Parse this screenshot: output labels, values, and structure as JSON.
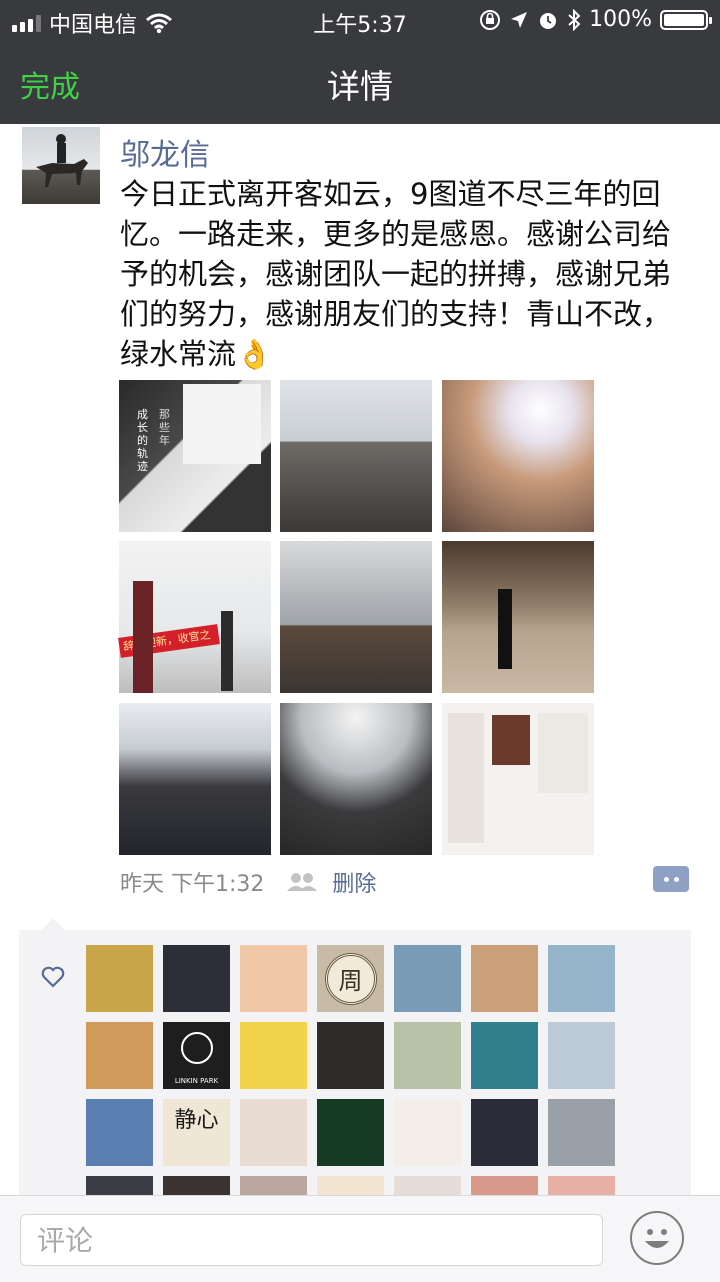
{
  "status_bar": {
    "carrier": "中国电信",
    "time": "上午5:37",
    "battery": "100%",
    "battery_level": 1.0
  },
  "nav": {
    "back_label": "完成",
    "title": "详情"
  },
  "post": {
    "author": "邬龙信",
    "text": "今日正式离开客如云，9图道不尽三年的回忆。一路走来，更多的是感恩。感谢公司给予的机会，感谢团队一起的拼搏，感谢兄弟们的努力，感谢朋友们的支持！青山不改，绿水常流👌",
    "photo_texts": {
      "wall_poster": "成长的轨迹",
      "wall_poster_2": "那些年",
      "banner": "辞旧迎新，收官之"
    },
    "time": "昨天 下午1:32",
    "delete_label": "删除"
  },
  "likes": {
    "rows": 4,
    "per_row": 7,
    "logo_text": "LINKIN PARK",
    "badge_text": "周",
    "calligraphy_text": "静心"
  },
  "comment": {
    "placeholder": "评论"
  },
  "colors": {
    "accent_green": "#3fd147",
    "link_blue": "#576b95",
    "topbar": "#393a3e"
  }
}
